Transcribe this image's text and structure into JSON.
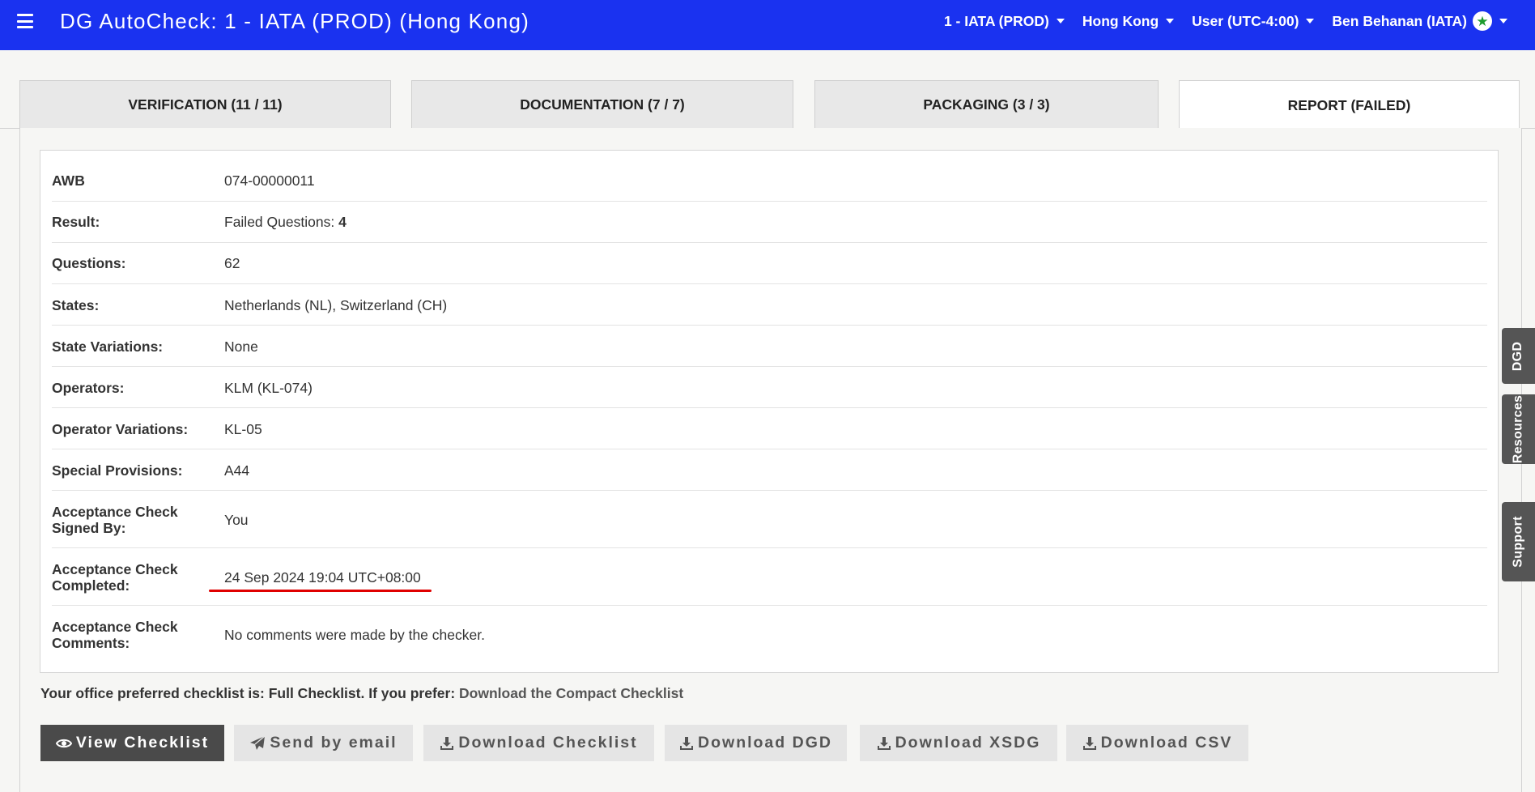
{
  "header": {
    "title": "DG AutoCheck: 1 - IATA (PROD) (Hong Kong)",
    "menus": [
      {
        "label": "1 - IATA (PROD)"
      },
      {
        "label": "Hong Kong"
      },
      {
        "label": "User (UTC-4:00)"
      },
      {
        "label": "Ben Behanan (IATA)"
      }
    ]
  },
  "tabs": [
    {
      "label": "VERIFICATION (11 / 11)",
      "active": false
    },
    {
      "label": "DOCUMENTATION (7 / 7)",
      "active": false
    },
    {
      "label": "PACKAGING (3 / 3)",
      "active": false
    },
    {
      "label": "REPORT (FAILED)",
      "active": true
    }
  ],
  "report": {
    "rows": [
      {
        "label": "AWB",
        "value": "074-00000011"
      },
      {
        "label": "Result:",
        "value": "Failed Questions:",
        "value_strong": "4"
      },
      {
        "label": "Questions:",
        "value": "62"
      },
      {
        "label": "States:",
        "value": "Netherlands (NL), Switzerland (CH)"
      },
      {
        "label": "State Variations:",
        "value": "None"
      },
      {
        "label": "Operators:",
        "value": "KLM (KL-074)"
      },
      {
        "label": "Operator Variations:",
        "value": "KL-05"
      },
      {
        "label": "Special Provisions:",
        "value": "A44"
      },
      {
        "label": "Acceptance Check Signed By:",
        "value": "You"
      },
      {
        "label": "Acceptance Check Completed:",
        "value": "24 Sep 2024 19:04 UTC+08:00"
      },
      {
        "label": "Acceptance Check Comments:",
        "value": "No comments were made by the checker."
      }
    ]
  },
  "preference": {
    "text": "Your office preferred checklist is: Full Checklist. If you prefer:",
    "link": "Download the Compact Checklist"
  },
  "buttons": [
    {
      "label": "View Checklist",
      "icon": "eye-icon"
    },
    {
      "label": "Send by email",
      "icon": "paper-plane-icon"
    },
    {
      "label": "Download Checklist",
      "icon": "download-icon"
    },
    {
      "label": "Download DGD",
      "icon": "download-icon"
    },
    {
      "label": "Download XSDG",
      "icon": "download-icon"
    },
    {
      "label": "Download CSV",
      "icon": "download-icon"
    }
  ],
  "side_tabs": [
    {
      "label": "DGD"
    },
    {
      "label": "Resources"
    },
    {
      "label": "Support"
    }
  ],
  "colors": {
    "header_bg": "#1a32f0",
    "highlight_underline": "#e00000",
    "primary_button": "#4a4a4a",
    "star_badge": "#1e9b2e"
  }
}
